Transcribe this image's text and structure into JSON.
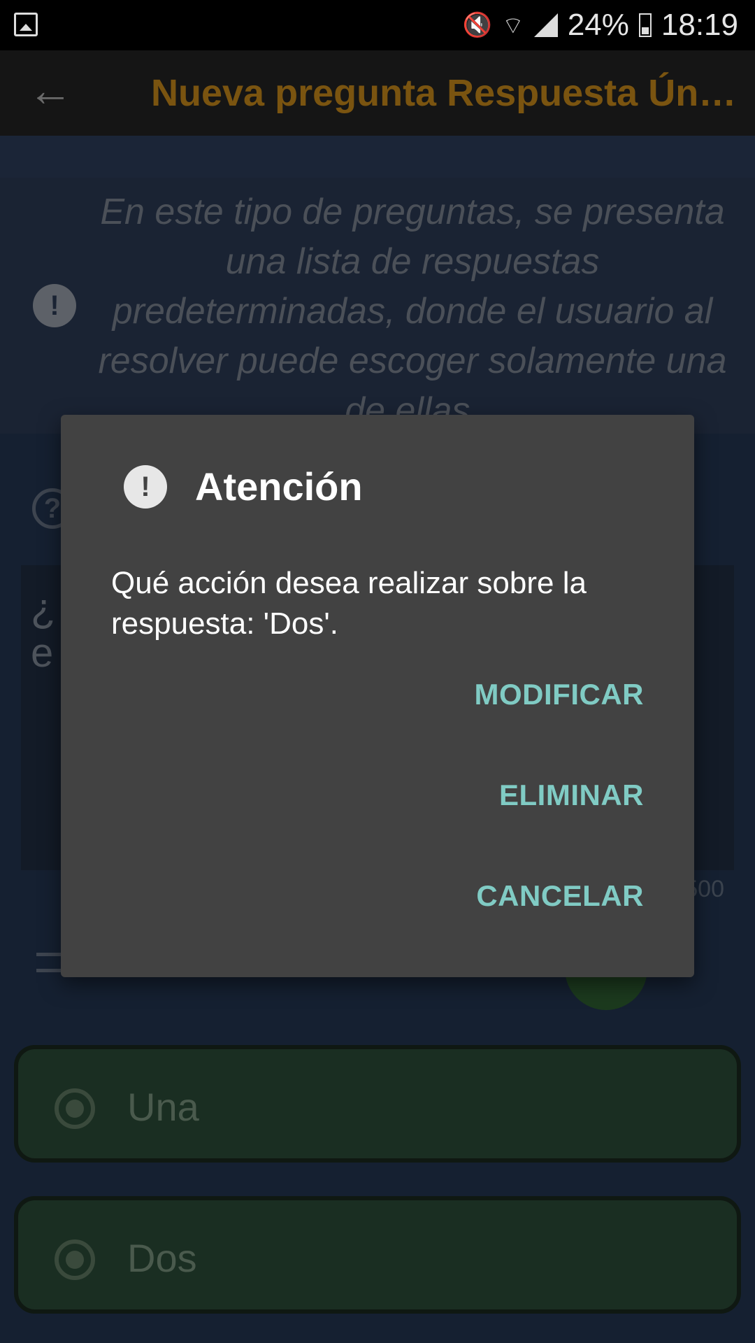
{
  "status_bar": {
    "battery": "24%",
    "time": "18:19",
    "icons": [
      "gallery-icon",
      "mute-icon",
      "wifi-icon",
      "signal-icon",
      "battery-charging-icon"
    ]
  },
  "app_bar": {
    "back_icon": "arrow-left-icon",
    "title": "Nueva pregunta Respuesta Única"
  },
  "info": {
    "icon": "exclamation-icon",
    "text": "En este tipo de preguntas, se presenta una lista de respuestas predeterminadas, donde el usuario al resolver puede escoger solamente una de ellas."
  },
  "question": {
    "icon": "help-icon",
    "text_visible": "¿\ne",
    "counter": "500"
  },
  "answers": [
    {
      "label": "Una"
    },
    {
      "label": "Dos"
    }
  ],
  "dialog": {
    "icon": "exclamation-icon",
    "title": "Atención",
    "message": "Qué acción desea realizar sobre la respuesta: 'Dos'.",
    "buttons": {
      "modify": "MODIFICAR",
      "delete": "ELIMINAR",
      "cancel": "CANCELAR"
    }
  },
  "colors": {
    "accent": "#80cbc4",
    "title": "#7a5410",
    "answer_bg": "#1a2e22"
  }
}
